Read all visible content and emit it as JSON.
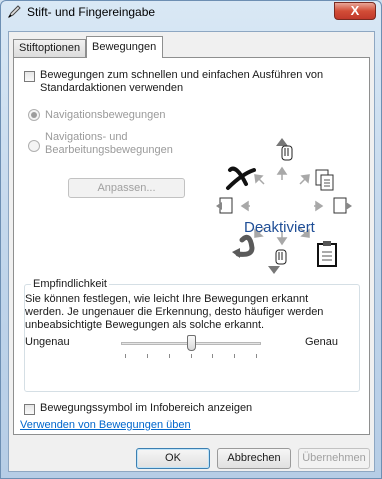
{
  "window": {
    "title": "Stift- und Fingereingabe",
    "close_label": "X"
  },
  "tabs": [
    {
      "label": "Stiftoptionen",
      "active": false
    },
    {
      "label": "Bewegungen",
      "active": true
    }
  ],
  "main": {
    "enable_checkbox_label_line1": "Bewegungen zum schnellen und einfachen Ausführen von",
    "enable_checkbox_label_line2": "Standardaktionen verwenden",
    "enable_checked": false,
    "radio_nav": "Navigationsbewegungen",
    "radio_edit_line1": "Navigations- und",
    "radio_edit_line2": "Bearbeitungsbewegungen",
    "customize_button": "Anpassen...",
    "status_text": "Deaktiviert"
  },
  "sensitivity": {
    "title": "Empfindlichkeit",
    "desc_line1": "Sie können festlegen, wie leicht Ihre Bewegungen erkannt",
    "desc_line2": "werden. Je ungenauer die Erkennung, desto häufiger werden",
    "desc_line3": "unbeabsichtigte Bewegungen als solche erkannt.",
    "min_label": "Ungenau",
    "max_label": "Genau",
    "slider_value": 0.5,
    "tick_count": 7
  },
  "footer": {
    "tray_checkbox_label": "Bewegungssymbol im Infobereich anzeigen",
    "tray_checked": false,
    "practice_link": "Verwenden von Bewegungen üben"
  },
  "buttons": {
    "ok": "OK",
    "cancel": "Abbrechen",
    "apply": "Übernehmen"
  },
  "colors": {
    "link": "#0066cc",
    "status_text": "#1f4e96",
    "close_button": "#c0392b"
  },
  "icons": [
    "pen-icon",
    "close-icon",
    "delete-gesture-icon",
    "up-hand-icon",
    "copy-icon",
    "back-icon",
    "forward-icon",
    "undo-icon",
    "down-hand-icon",
    "paste-icon"
  ]
}
